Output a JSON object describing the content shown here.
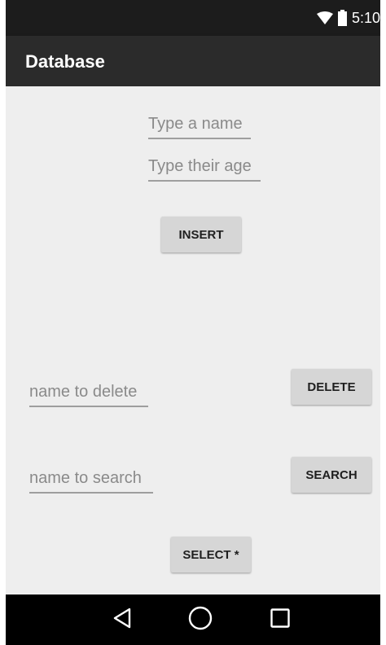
{
  "status_bar": {
    "time": "5:10",
    "wifi_icon": "wifi-icon",
    "battery_icon": "battery-icon"
  },
  "app_bar": {
    "title": "Database"
  },
  "form": {
    "name_placeholder": "Type a name",
    "age_placeholder": "Type their age",
    "insert_label": "INSERT",
    "delete_placeholder": "name to delete",
    "delete_label": "DELETE",
    "search_placeholder": "name to search",
    "search_label": "SEARCH",
    "select_label": "SELECT *"
  },
  "nav_bar": {
    "back_icon": "back-triangle-icon",
    "home_icon": "home-circle-icon",
    "recents_icon": "recents-square-icon"
  },
  "colors": {
    "background": "#eeeeee",
    "status_bar": "#1c1c1c",
    "app_bar": "#2b2b2b",
    "button": "#d6d6d6",
    "hint_text": "#8a8a8a",
    "nav_bar": "#000000"
  }
}
